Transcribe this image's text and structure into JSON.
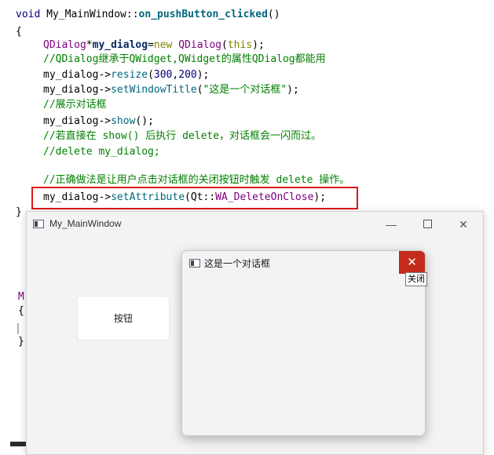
{
  "code": {
    "l1": {
      "kw": "void ",
      "cls": "My_MainWindow",
      "sep": "::",
      "fn": "on_pushButton_clicked",
      "tail": "()"
    },
    "l2": "{",
    "l3": {
      "ty": "QDialog",
      "star": "*",
      "var": "my_dialog",
      "eq": "=",
      "nw": "new ",
      "ty2": "QDialog",
      "p1": "(",
      "th": "this",
      "p2": ");"
    },
    "l4": "//QDialog继承于QWidget,QWidget的属性QDialog都能用",
    "l5": {
      "obj": "my_dialog",
      "arrow": "->",
      "m": "resize",
      "p1": "(",
      "n1": "300",
      "c": ",",
      "n2": "200",
      "p2": ");"
    },
    "l6": {
      "obj": "my_dialog",
      "arrow": "->",
      "m": "setWindowTitle",
      "p1": "(",
      "s": "\"这是一个对话框\"",
      "p2": ");"
    },
    "l7": "//展示对话框",
    "l8": {
      "obj": "my_dialog",
      "arrow": "->",
      "m": "show",
      "p": "();"
    },
    "l9": "//若直接在 show() 后执行 delete，对话框会一闪而过。",
    "l10": "//delete my_dialog;",
    "l11": "//正确做法是让用户点击对话框的关闭按钮时触发 delete 操作。",
    "l12": {
      "obj": "my_dialog",
      "arrow": "->",
      "m": "setAttribute",
      "p1": "(",
      "ns": "Qt",
      "sep": "::",
      "en": "WA_DeleteOnClose",
      "p2": ");"
    },
    "l13": "}",
    "bg_m": "M",
    "bg_brace_open": "{",
    "bg_brace_close": "}"
  },
  "main_window": {
    "title": "My_MainWindow",
    "minimize": "—",
    "close": "✕",
    "button_label": "按钮"
  },
  "dialog": {
    "title": "这是一个对话框",
    "close": "✕",
    "tooltip": "关闭"
  }
}
